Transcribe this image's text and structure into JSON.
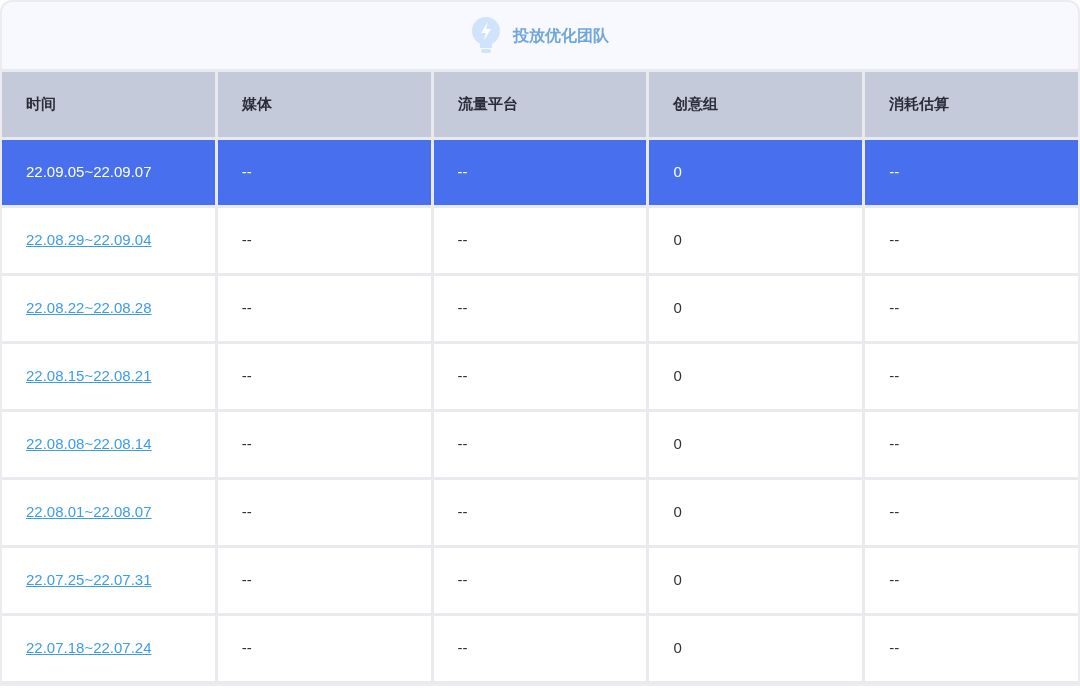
{
  "header": {
    "title": "投放优化团队"
  },
  "table": {
    "columns": [
      "时间",
      "媒体",
      "流量平台",
      "创意组",
      "消耗估算"
    ],
    "rows": [
      {
        "selected": true,
        "cells": [
          "22.09.05~22.09.07",
          "--",
          "--",
          "0",
          "--"
        ]
      },
      {
        "selected": false,
        "cells": [
          "22.08.29~22.09.04",
          "--",
          "--",
          "0",
          "--"
        ]
      },
      {
        "selected": false,
        "cells": [
          "22.08.22~22.08.28",
          "--",
          "--",
          "0",
          "--"
        ]
      },
      {
        "selected": false,
        "cells": [
          "22.08.15~22.08.21",
          "--",
          "--",
          "0",
          "--"
        ]
      },
      {
        "selected": false,
        "cells": [
          "22.08.08~22.08.14",
          "--",
          "--",
          "0",
          "--"
        ]
      },
      {
        "selected": false,
        "cells": [
          "22.08.01~22.08.07",
          "--",
          "--",
          "0",
          "--"
        ]
      },
      {
        "selected": false,
        "cells": [
          "22.07.25~22.07.31",
          "--",
          "--",
          "0",
          "--"
        ]
      },
      {
        "selected": false,
        "cells": [
          "22.07.18~22.07.24",
          "--",
          "--",
          "0",
          "--"
        ]
      }
    ]
  }
}
